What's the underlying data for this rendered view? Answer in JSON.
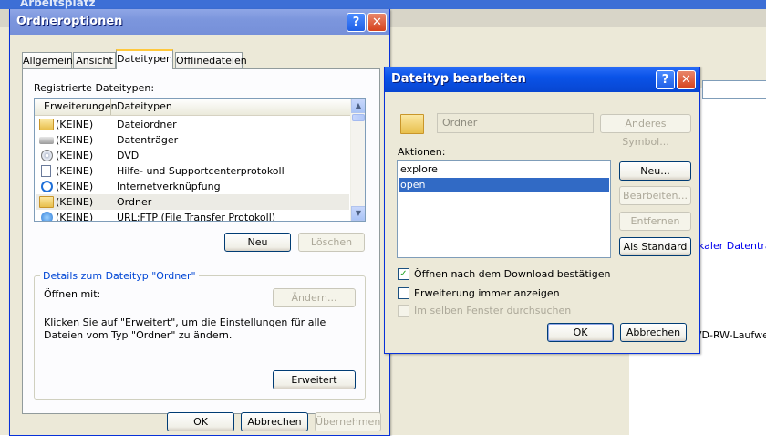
{
  "background_window": {
    "title": "Arbeitsplatz",
    "labels": [
      "kaler Datenträg",
      "VD-RW-Laufwer"
    ]
  },
  "ordneroptionen": {
    "title": "Ordneroptionen",
    "tabs": [
      "Allgemein",
      "Ansicht",
      "Dateitypen",
      "Offlinedateien"
    ],
    "active_tab": "Dateitypen",
    "registered_label": "Registrierte Dateitypen:",
    "columns": [
      "Erweiterungen",
      "Dateitypen"
    ],
    "rows": [
      {
        "ext": "(KEINE)",
        "type": "Dateiordner",
        "icon": "folder-icon"
      },
      {
        "ext": "(KEINE)",
        "type": "Datenträger",
        "icon": "drive-icon"
      },
      {
        "ext": "(KEINE)",
        "type": "DVD",
        "icon": "dvd-icon"
      },
      {
        "ext": "(KEINE)",
        "type": "Hilfe- und Supportcenterprotokoll",
        "icon": "document-icon"
      },
      {
        "ext": "(KEINE)",
        "type": "Internetverknüpfung",
        "icon": "internet-explorer-icon"
      },
      {
        "ext": "(KEINE)",
        "type": "Ordner",
        "icon": "folder-icon"
      },
      {
        "ext": "(KEINE)",
        "type": "URL:FTP (File Transfer Protokoll)",
        "icon": "globe-icon"
      }
    ],
    "selected_row": 5,
    "new_button": "Neu",
    "delete_button": "Löschen",
    "details_legend": "Details zum Dateityp \"Ordner\"",
    "open_with_label": "Öffnen mit:",
    "change_button": "Ändern...",
    "description": "Klicken Sie auf \"Erweitert\", um die Einstellungen für alle Dateien vom Typ \"Ordner\" zu ändern.",
    "advanced_button": "Erweitert",
    "ok_button": "OK",
    "cancel_button": "Abbrechen",
    "apply_button": "Übernehmen"
  },
  "dateityp_bearbeiten": {
    "title": "Dateityp bearbeiten",
    "type_name": "Ordner",
    "other_symbol_button": "Anderes Symbol...",
    "actions_label": "Aktionen:",
    "actions": [
      "explore",
      "open"
    ],
    "selected_action": "open",
    "new_button": "Neu...",
    "edit_button": "Bearbeiten...",
    "remove_button": "Entfernen",
    "default_button": "Als Standard",
    "options": [
      {
        "label": "Öffnen nach dem Download bestätigen",
        "checked": true,
        "enabled": true
      },
      {
        "label": "Erweiterung immer anzeigen",
        "checked": false,
        "enabled": true
      },
      {
        "label": "Im selben Fenster durchsuchen",
        "checked": false,
        "enabled": false
      }
    ],
    "ok_button": "OK",
    "cancel_button": "Abbrechen"
  },
  "colors": {
    "titlebar_active": "#0a53e8",
    "titlebar_inactive": "#7c96dd",
    "dialog_bg": "#ece9d8",
    "selection": "#316ac5"
  }
}
